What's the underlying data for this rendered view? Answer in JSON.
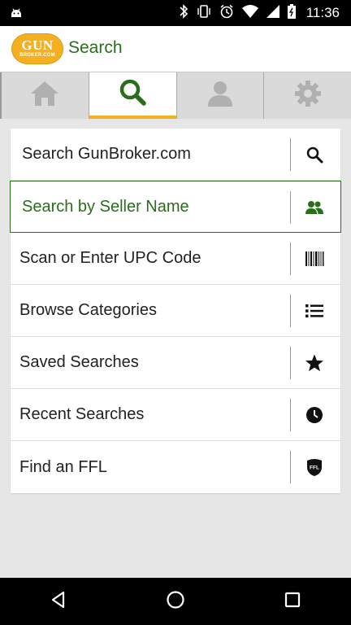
{
  "status": {
    "time": "11:36"
  },
  "app": {
    "title": "Search",
    "logo": {
      "main": "GUN",
      "sub": "BROKER.COM"
    }
  },
  "tabs": [
    {
      "icon": "home-icon",
      "active": false
    },
    {
      "icon": "search-icon",
      "active": true
    },
    {
      "icon": "user-icon",
      "active": false
    },
    {
      "icon": "gear-icon",
      "active": false
    }
  ],
  "search_options": [
    {
      "label": "Search GunBroker.com",
      "icon": "search-icon"
    },
    {
      "label": "Search by Seller Name",
      "icon": "sellers-icon"
    },
    {
      "label": "Scan or Enter UPC Code",
      "icon": "barcode-icon"
    },
    {
      "label": "Browse Categories",
      "icon": "list-icon"
    },
    {
      "label": "Saved Searches",
      "icon": "star-icon"
    },
    {
      "label": "Recent Searches",
      "icon": "clock-icon"
    },
    {
      "label": "Find an FFL",
      "icon": "ffl-badge-icon",
      "badge_text": "FFL"
    }
  ],
  "colors": {
    "accent": "#2a6d1b",
    "brand": "#f4b01e"
  }
}
